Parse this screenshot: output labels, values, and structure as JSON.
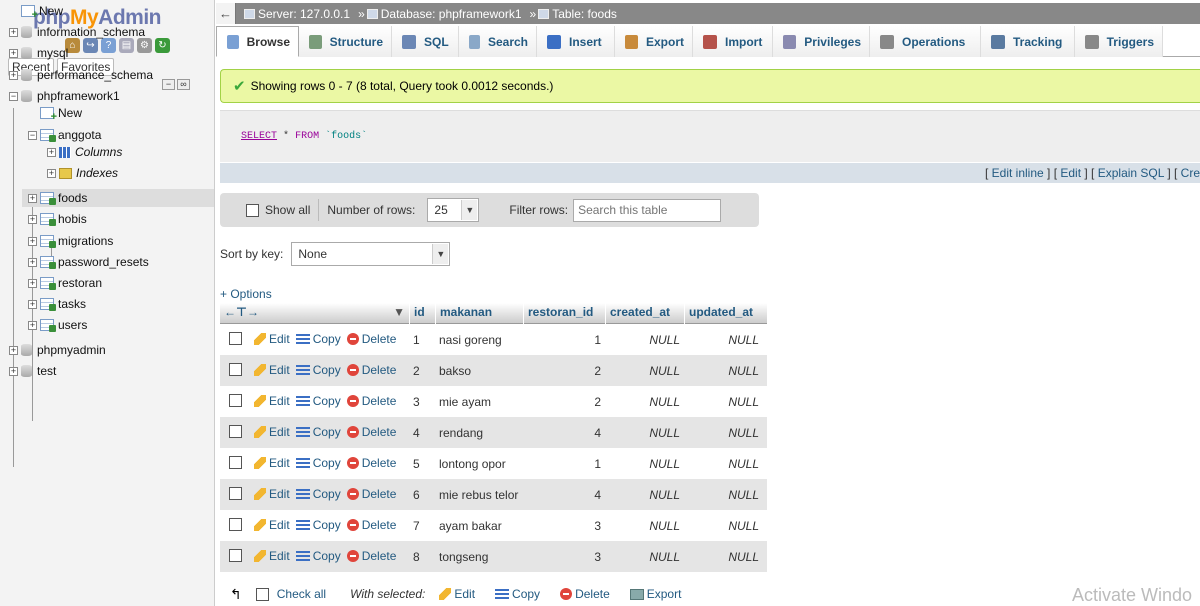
{
  "left_nav": {
    "logo": {
      "php": "php",
      "my": "My",
      "admin": "Admin"
    },
    "tabs": [
      "Recent",
      "Favorites"
    ],
    "tree": [
      {
        "label": "New",
        "kind": "new",
        "level": 0
      },
      {
        "label": "information_schema",
        "kind": "db",
        "level": 0
      },
      {
        "label": "mysql",
        "kind": "db",
        "level": 0
      },
      {
        "label": "performance_schema",
        "kind": "db",
        "level": 0
      },
      {
        "label": "phpframework1",
        "kind": "db",
        "level": 0,
        "expanded": true
      },
      {
        "label": "New",
        "kind": "new",
        "level": 1
      },
      {
        "label": "anggota",
        "kind": "table",
        "level": 1,
        "expanded": true
      },
      {
        "label": "Columns",
        "kind": "columns",
        "level": 2
      },
      {
        "label": "Indexes",
        "kind": "indexes",
        "level": 2
      },
      {
        "label": "foods",
        "kind": "table",
        "level": 1,
        "selected": true
      },
      {
        "label": "hobis",
        "kind": "table",
        "level": 1
      },
      {
        "label": "migrations",
        "kind": "table",
        "level": 1
      },
      {
        "label": "password_resets",
        "kind": "table",
        "level": 1
      },
      {
        "label": "restoran",
        "kind": "table",
        "level": 1
      },
      {
        "label": "tasks",
        "kind": "table",
        "level": 1
      },
      {
        "label": "users",
        "kind": "table",
        "level": 1
      },
      {
        "label": "phpmyadmin",
        "kind": "db",
        "level": 0
      },
      {
        "label": "test",
        "kind": "db",
        "level": 0
      }
    ]
  },
  "breadcrumb": {
    "server": "Server: 127.0.0.1",
    "database": "Database: phpframework1",
    "table": "Table: foods",
    "sep": "»"
  },
  "tabs": [
    {
      "label": "Browse",
      "active": true,
      "icon": "browse-icon"
    },
    {
      "label": "Structure",
      "icon": "structure-icon"
    },
    {
      "label": "SQL",
      "icon": "sql-icon"
    },
    {
      "label": "Search",
      "icon": "search-icon"
    },
    {
      "label": "Insert",
      "icon": "insert-icon"
    },
    {
      "label": "Export",
      "icon": "export-icon"
    },
    {
      "label": "Import",
      "icon": "import-icon"
    },
    {
      "label": "Privileges",
      "icon": "privileges-icon"
    },
    {
      "label": "Operations",
      "icon": "operations-icon"
    },
    {
      "label": "Tracking",
      "icon": "tracking-icon"
    },
    {
      "label": "Triggers",
      "icon": "triggers-icon"
    }
  ],
  "message": "Showing rows 0 - 7 (8 total, Query took 0.0012 seconds.)",
  "sql": {
    "select": "SELECT",
    "star": "*",
    "from": "FROM",
    "table": "`foods`"
  },
  "sql_links": [
    "Edit inline",
    "Edit",
    "Explain SQL",
    "Cre"
  ],
  "navbar": {
    "show_all": "Show all",
    "num_rows_label": "Number of rows:",
    "num_rows_value": "25",
    "filter_label": "Filter rows:",
    "filter_placeholder": "Search this table"
  },
  "sort": {
    "label": "Sort by key:",
    "value": "None"
  },
  "options_link": "+ Options",
  "table": {
    "columns": [
      "id",
      "makanan",
      "restoran_id",
      "created_at",
      "updated_at"
    ],
    "actions": {
      "edit": "Edit",
      "copy": "Copy",
      "delete": "Delete"
    },
    "rows": [
      {
        "id": "1",
        "makanan": "nasi goreng",
        "restoran_id": "1",
        "created_at": "NULL",
        "updated_at": "NULL"
      },
      {
        "id": "2",
        "makanan": "bakso",
        "restoran_id": "2",
        "created_at": "NULL",
        "updated_at": "NULL"
      },
      {
        "id": "3",
        "makanan": "mie ayam",
        "restoran_id": "2",
        "created_at": "NULL",
        "updated_at": "NULL"
      },
      {
        "id": "4",
        "makanan": "rendang",
        "restoran_id": "4",
        "created_at": "NULL",
        "updated_at": "NULL"
      },
      {
        "id": "5",
        "makanan": "lontong opor",
        "restoran_id": "1",
        "created_at": "NULL",
        "updated_at": "NULL"
      },
      {
        "id": "6",
        "makanan": "mie rebus telor",
        "restoran_id": "4",
        "created_at": "NULL",
        "updated_at": "NULL"
      },
      {
        "id": "7",
        "makanan": "ayam bakar",
        "restoran_id": "3",
        "created_at": "NULL",
        "updated_at": "NULL"
      },
      {
        "id": "8",
        "makanan": "tongseng",
        "restoran_id": "3",
        "created_at": "NULL",
        "updated_at": "NULL"
      }
    ]
  },
  "footer": {
    "check_all": "Check all",
    "with_selected": "With selected:",
    "edit": "Edit",
    "copy": "Copy",
    "delete": "Delete",
    "export": "Export"
  },
  "watermark": "Activate Windo"
}
